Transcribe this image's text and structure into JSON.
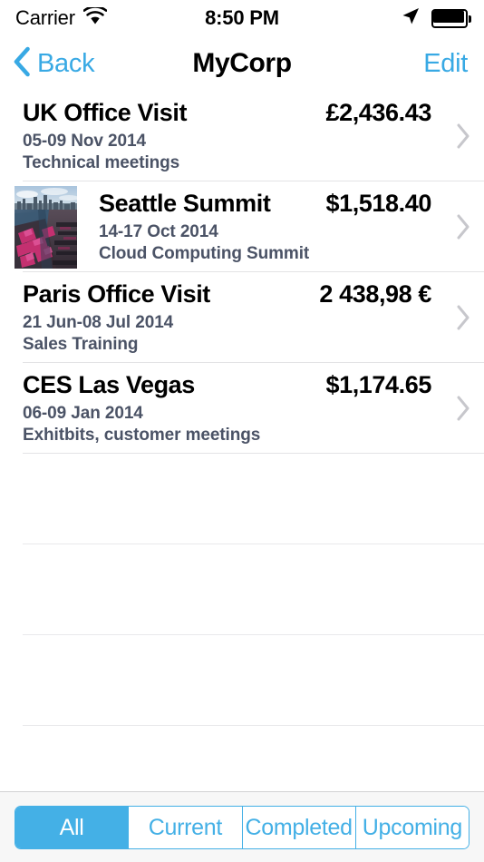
{
  "status_bar": {
    "carrier": "Carrier",
    "wifi_icon": "wifi-icon",
    "time": "8:50 PM",
    "location_icon": "location-arrow-icon",
    "battery_icon": "battery-full-icon"
  },
  "nav_bar": {
    "back_icon": "chevron-left-icon",
    "back_label": "Back",
    "title": "MyCorp",
    "edit_label": "Edit",
    "tint_color": "#38a9e4"
  },
  "trips": [
    {
      "title": "UK Office Visit",
      "amount": "£2,436.43",
      "dates": "05-09 Nov 2014",
      "description": "Technical meetings",
      "thumbnail": null,
      "disclosure_icon": "chevron-right-icon"
    },
    {
      "title": "Seattle Summit",
      "amount": "$1,518.40",
      "dates": "14-17 Oct 2014",
      "description": "Cloud Computing Summit",
      "thumbnail": "seattle-harbor-photo",
      "disclosure_icon": "chevron-right-icon"
    },
    {
      "title": "Paris Office Visit",
      "amount": "2 438,98 €",
      "dates": "21 Jun-08 Jul 2014",
      "description": "Sales Training",
      "thumbnail": null,
      "disclosure_icon": "chevron-right-icon"
    },
    {
      "title": "CES Las Vegas",
      "amount": "$1,174.65",
      "dates": "06-09 Jan 2014",
      "description": "Exhitbits, customer meetings",
      "thumbnail": null,
      "disclosure_icon": "chevron-right-icon"
    }
  ],
  "empty_row_count": 4,
  "filter_control": {
    "selected": "All",
    "options": [
      {
        "label": "All"
      },
      {
        "label": "Current"
      },
      {
        "label": "Completed"
      },
      {
        "label": "Upcoming"
      }
    ],
    "tint_color": "#44b0e6"
  }
}
